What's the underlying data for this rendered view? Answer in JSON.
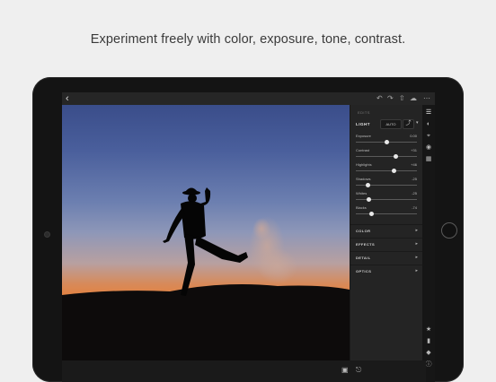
{
  "headline": "Experiment freely with color, exposure, tone, contrast.",
  "colors": {
    "background": "#efefef",
    "device": "#141414",
    "panel": "#242424",
    "accent_knob": "#e8e8e8"
  },
  "topbar": {
    "back_icon": "chevron-left-icon",
    "icons": [
      "undo-icon",
      "redo-icon",
      "share-icon",
      "cloud-sync-icon",
      "more-icon"
    ]
  },
  "panel": {
    "crumb": "EDITS",
    "light": {
      "heading": "LIGHT",
      "auto_label": "AUTO",
      "sliders": [
        {
          "label": "Exposure",
          "value": "0.00",
          "level": 0.5
        },
        {
          "label": "Contrast",
          "value": "+31",
          "level": 0.66
        },
        {
          "label": "Highlights",
          "value": "+46",
          "level": 0.62
        },
        {
          "label": "Shadows",
          "value": "-25",
          "level": 0.2
        },
        {
          "label": "Whites",
          "value": "-25",
          "level": 0.22
        },
        {
          "label": "Blacks",
          "value": "-74",
          "level": 0.25
        }
      ]
    },
    "sections": [
      {
        "label": "COLOR"
      },
      {
        "label": "EFFECTS"
      },
      {
        "label": "DETAIL"
      },
      {
        "label": "OPTICS"
      }
    ]
  },
  "rail": {
    "top_icons": [
      "sliders-icon",
      "color-icon",
      "crop-icon",
      "filter-icon",
      "preset-icon"
    ],
    "bottom_icons": [
      "star-icon",
      "comment-icon",
      "tag-icon",
      "info-icon"
    ]
  },
  "bottombar": {
    "icons": [
      "compare-icon",
      "undo-history-icon"
    ]
  }
}
